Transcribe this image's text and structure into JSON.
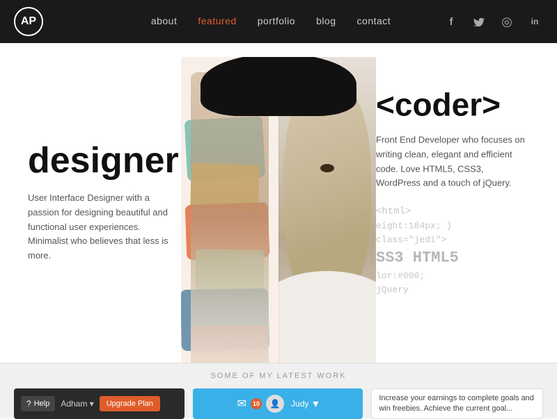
{
  "navbar": {
    "logo": "AP",
    "links": [
      {
        "label": "about",
        "active": false
      },
      {
        "label": "featured",
        "active": true
      },
      {
        "label": "portfolio",
        "active": false
      },
      {
        "label": "blog",
        "active": false
      },
      {
        "label": "contact",
        "active": false
      }
    ],
    "social": [
      {
        "name": "facebook",
        "icon": "f"
      },
      {
        "name": "twitter",
        "icon": "t"
      },
      {
        "name": "dribbble",
        "icon": "◎"
      },
      {
        "name": "linkedin",
        "icon": "in"
      }
    ]
  },
  "hero": {
    "designer_title": "designer",
    "designer_desc": "User Interface Designer with a passion for designing beautiful and functional user experiences. Minimalist who believes that less is more.",
    "coder_title": "<coder>",
    "coder_desc": "Front End Developer who focuses on writing clean, elegant and efficient code. Love HTML5, CSS3, WordPress and a touch of jQuery.",
    "code_lines": [
      "<html>",
      "eight:184px; }",
      "class=\"jedi\">",
      "SS3 HTML5",
      "lor:#000;",
      "jQuery"
    ]
  },
  "bottom": {
    "section_title": "SOME OF MY LATEST WORK",
    "item1": {
      "help": "Help",
      "user": "Adham",
      "upgrade": "Upgrade Plan"
    },
    "item2": {
      "notifications": "10",
      "user": "Judy"
    },
    "item3": {
      "text": "Increase your earnings to complete goals and win freebies. Achieve the current goal..."
    }
  }
}
